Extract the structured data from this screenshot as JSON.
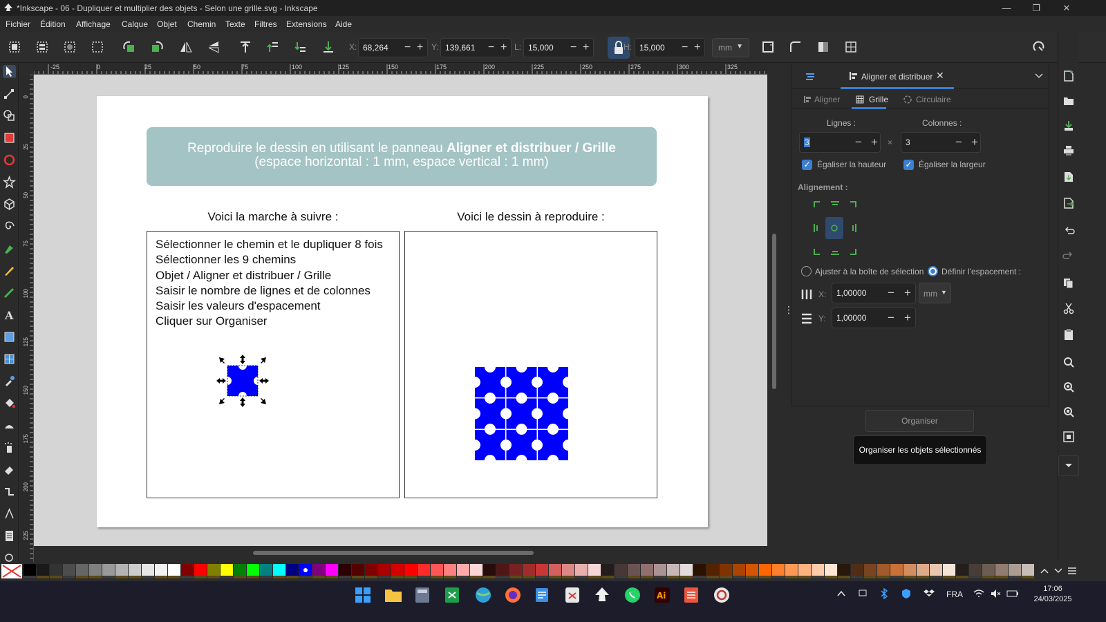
{
  "window": {
    "title": "*Inkscape - 06 - Dupliquer et multiplier des objets - Selon une grille.svg - Inkscape",
    "minimize": "—",
    "maximize": "❐",
    "close": "✕"
  },
  "menu": [
    "Fichier",
    "Édition",
    "Affichage",
    "Calque",
    "Objet",
    "Chemin",
    "Texte",
    "Filtres",
    "Extensions",
    "Aide"
  ],
  "toolbar": {
    "x_label": "X:",
    "x_value": "68,264",
    "y_label": "Y:",
    "y_value": "139,661",
    "w_label": "L:",
    "w_value": "15,000",
    "h_label": "H:",
    "h_value": "15,000",
    "unit": "mm",
    "minus": "−",
    "plus": "+"
  },
  "ruler_top": [
    "-25",
    "0",
    "25",
    "50",
    "75",
    "100",
    "125",
    "150",
    "175",
    "200",
    "225",
    "250",
    "275",
    "300",
    "325"
  ],
  "ruler_left": [
    "0",
    "25",
    "50",
    "75",
    "100",
    "125",
    "150",
    "175",
    "200",
    "225"
  ],
  "document": {
    "banner_line1_prefix": "Reproduire le dessin en utilisant le panneau ",
    "banner_line1_bold": "Aligner et distribuer / Grille",
    "banner_line2": "(espace horizontal : 1 mm, espace vertical : 1 mm)",
    "left_heading": "Voici la marche à suivre :",
    "right_heading": "Voici le dessin à reproduire :",
    "steps": [
      "Sélectionner le chemin et le dupliquer 8 fois",
      "Sélectionner les 9 chemins",
      "Objet / Aligner et distribuer / Grille",
      "Saisir le nombre de lignes et de colonnes",
      "Saisir les valeurs d'espacement",
      "Cliquer sur Organiser"
    ],
    "shape_color": "#0000ff"
  },
  "panel": {
    "tab_title": "Aligner et distribuer",
    "tab_close": "✕",
    "subtabs": [
      "Aligner",
      "Grille",
      "Circulaire"
    ],
    "rows_label": "Lignes :",
    "cols_label": "Colonnes :",
    "rows_value": "3",
    "cols_value": "3",
    "times": "×",
    "equal_height": "Égaliser la hauteur",
    "equal_width": "Égaliser la largeur",
    "alignment_label": "Alignement :",
    "fit_bbox": "Ajuster à la boîte de sélection",
    "set_spacing": "Définir l'espacement :",
    "x_axis": "X:",
    "y_axis": "Y:",
    "x_spacing": "1,00000",
    "y_spacing": "1,00000",
    "unit": "mm",
    "arrange_button": "Organiser",
    "tooltip": "Organiser les objets sélectionnés"
  },
  "taskbar": {
    "language": "FRA",
    "time": "17:06",
    "date": "24/03/2025"
  },
  "accent_color": "#3b7fd1"
}
